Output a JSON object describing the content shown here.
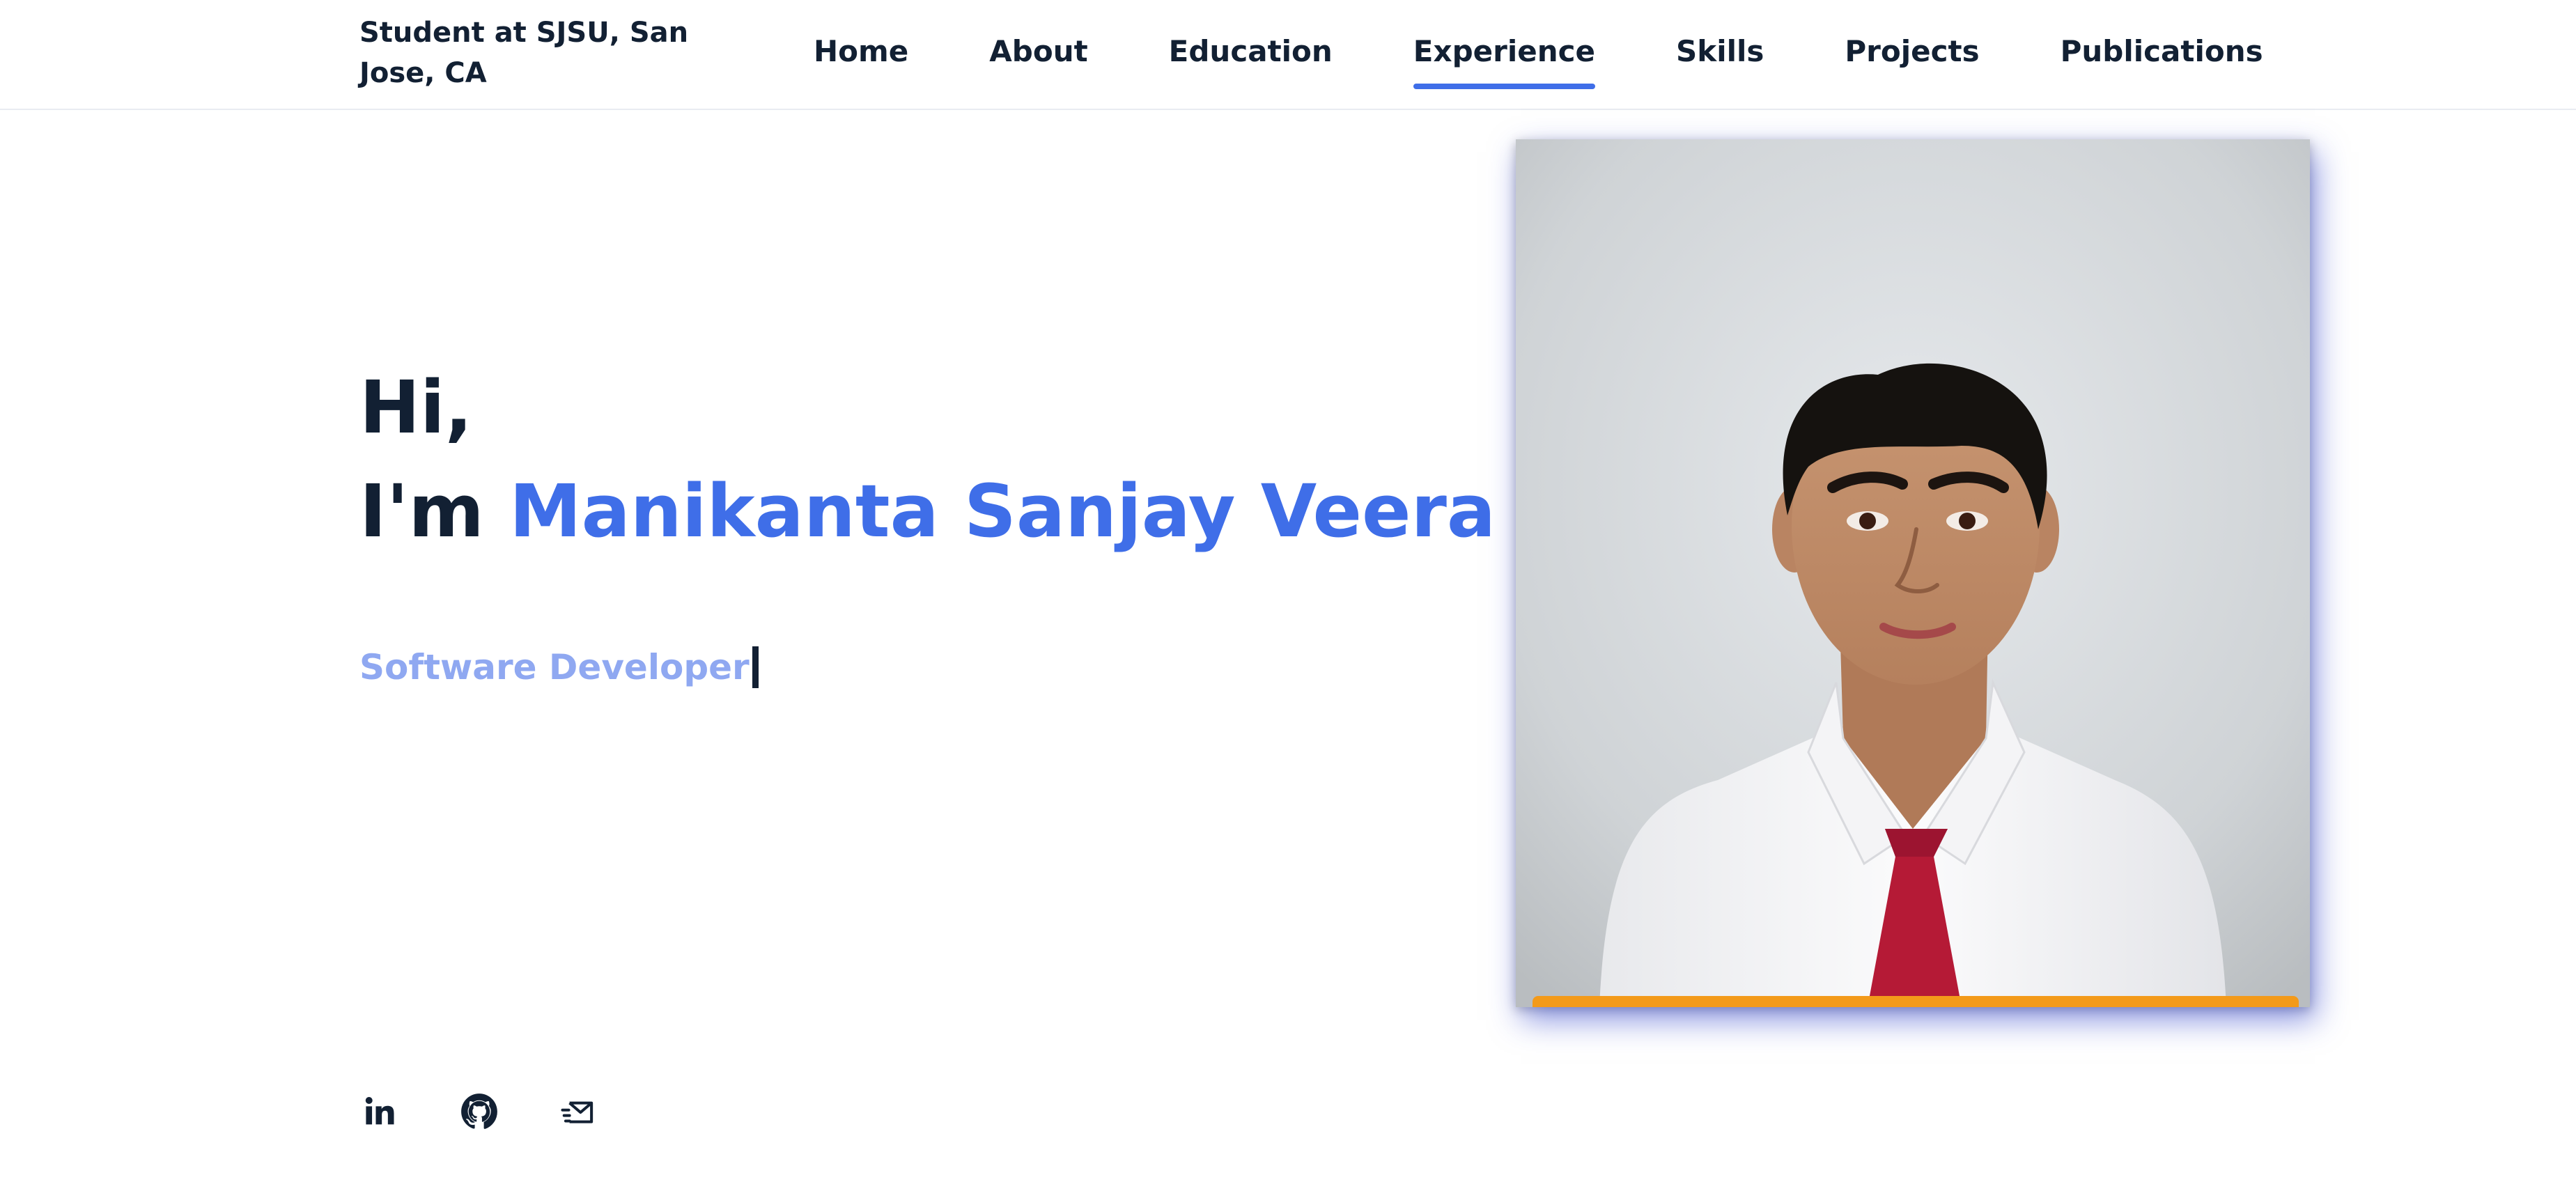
{
  "header": {
    "brand": "Student at SJSU, San Jose, CA",
    "nav": [
      {
        "label": "Home"
      },
      {
        "label": "About"
      },
      {
        "label": "Education"
      },
      {
        "label": "Experience",
        "active": true
      },
      {
        "label": "Skills"
      },
      {
        "label": "Projects"
      },
      {
        "label": "Publications"
      }
    ]
  },
  "hero": {
    "greeting": "Hi,",
    "intro_prefix": "I'm",
    "name": "Manikanta Sanjay Veera",
    "role": "Software Developer"
  },
  "socials": [
    {
      "icon": "linkedin-icon"
    },
    {
      "icon": "github-icon"
    },
    {
      "icon": "mail-icon"
    }
  ],
  "colors": {
    "accent": "#3f6ee8",
    "role_text": "#8fa8f1",
    "dark_text": "#122033",
    "portrait_base": "#f39a1a"
  }
}
